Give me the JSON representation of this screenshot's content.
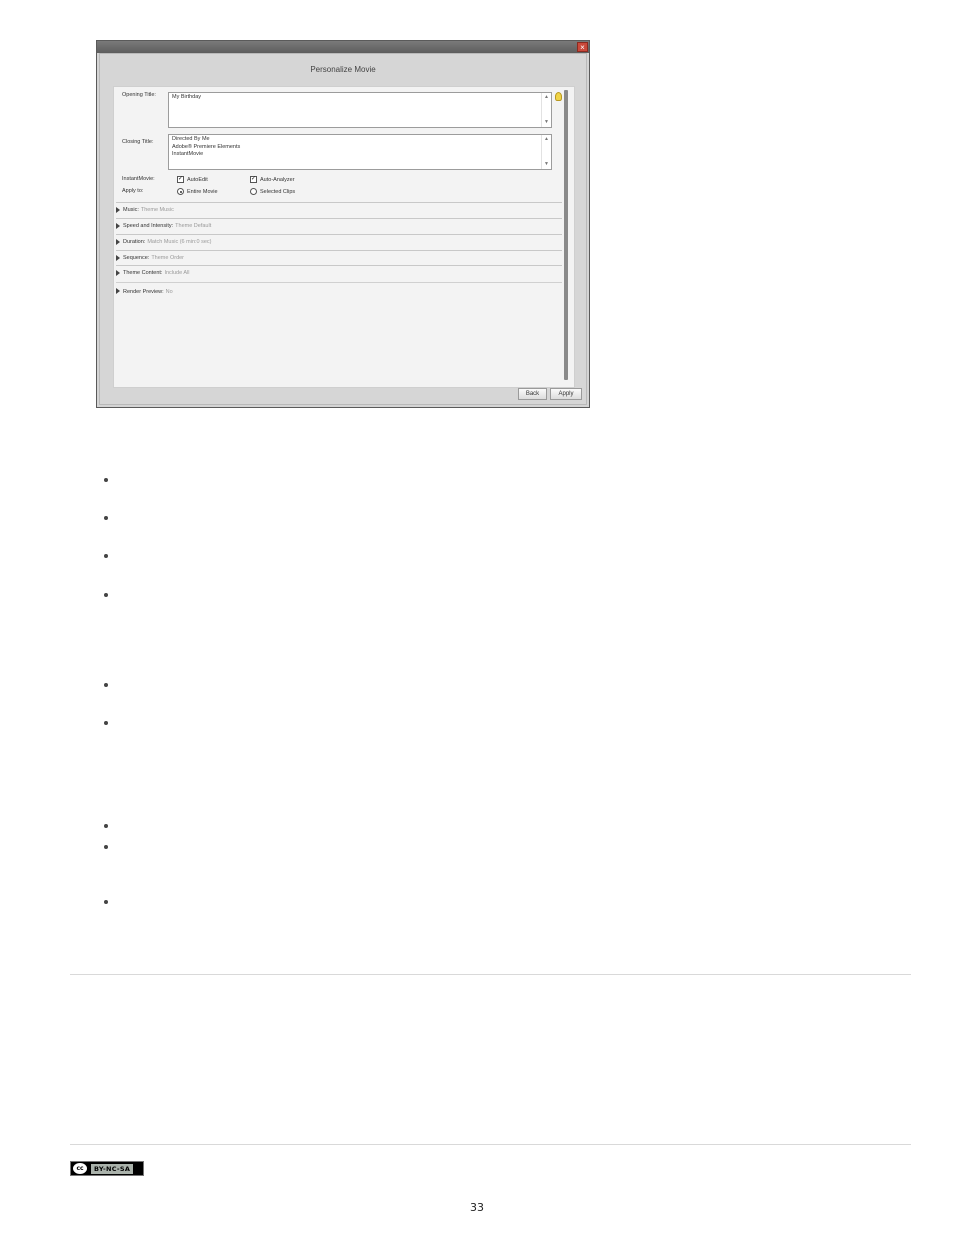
{
  "dialog": {
    "title": "Personalize Movie",
    "close_glyph": "×",
    "opening_title": {
      "label": "Opening Title:",
      "value": "My Birthday"
    },
    "closing_title": {
      "label": "Closing Title:",
      "lines": [
        "Directed By Me",
        "Adobe® Premiere Elements",
        "InstantMovie"
      ]
    },
    "instant_movie": {
      "label": "InstantMovie:",
      "options": [
        {
          "label": "AutoEdit",
          "checked": true
        },
        {
          "label": "Auto-Analyzer",
          "checked": true
        }
      ]
    },
    "apply_to": {
      "label": "Apply to:",
      "options": [
        {
          "label": "Entire Movie",
          "selected": true
        },
        {
          "label": "Selected Clips",
          "selected": false
        }
      ]
    },
    "sections": [
      {
        "name": "Music:",
        "value": "Theme Music"
      },
      {
        "name": "Speed and Intensity:",
        "value": "Theme Default"
      },
      {
        "name": "Duration:",
        "value": "Match Music (6 min:0 sec)"
      },
      {
        "name": "Sequence:",
        "value": "Theme Order"
      },
      {
        "name": "Theme Content:",
        "value": "Include All"
      },
      {
        "name": "Render Preview:",
        "value": "No"
      }
    ],
    "buttons": {
      "back": "Back",
      "apply": "Apply"
    },
    "icons": {
      "close": "close-icon",
      "tip": "lightbulb-icon",
      "expand": "triangle-right-icon"
    }
  },
  "footer": {
    "license": {
      "cc": "cc",
      "text": "BY-NC-SA"
    },
    "page_number": "33"
  }
}
